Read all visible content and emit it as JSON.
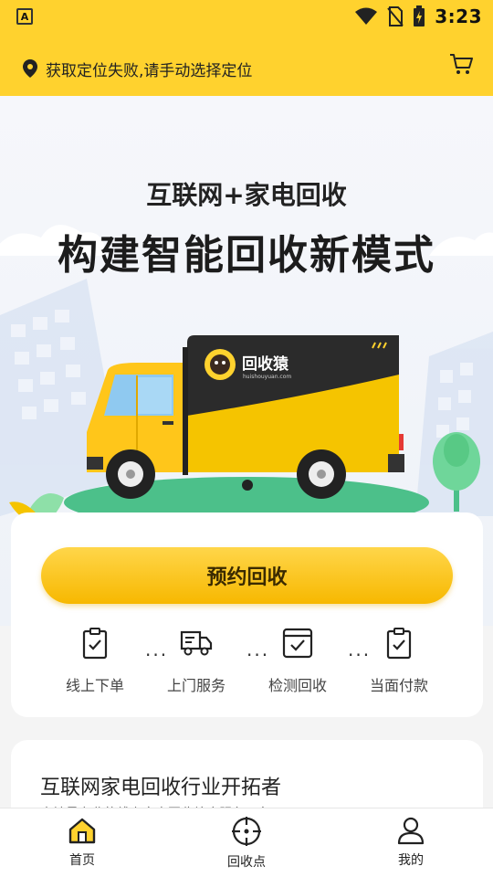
{
  "status_bar": {
    "notification_badge": "A",
    "time": "3:23"
  },
  "location_bar": {
    "text": "获取定位失败,请手动选择定位"
  },
  "hero": {
    "subtitle": "互联网+家电回收",
    "title": "构建智能回收新模式",
    "truck_brand": "回收猿",
    "truck_domain": "huishouyuan.com"
  },
  "booking": {
    "button_label": "预约回收",
    "steps": [
      {
        "label": "线上下单",
        "icon": "clipboard-check-icon"
      },
      {
        "label": "上门服务",
        "icon": "truck-icon"
      },
      {
        "label": "检测回收",
        "icon": "box-check-icon"
      },
      {
        "label": "当面付款",
        "icon": "clipboard-check-icon"
      }
    ],
    "separator": "..."
  },
  "info_card": {
    "heading": "互联网家电回收行业开拓者",
    "text": "本地最专业的线上家电回收综合服务平台"
  },
  "tab_bar": {
    "tabs": [
      {
        "label": "首页",
        "icon": "home-icon"
      },
      {
        "label": "回收点",
        "icon": "crosshair-icon"
      },
      {
        "label": "我的",
        "icon": "user-icon"
      }
    ]
  },
  "colors": {
    "brand_yellow": "#ffd22e",
    "button_yellow": "#f7b800",
    "truck_dark": "#2b2b2b",
    "grass_green": "#4cc08a"
  }
}
